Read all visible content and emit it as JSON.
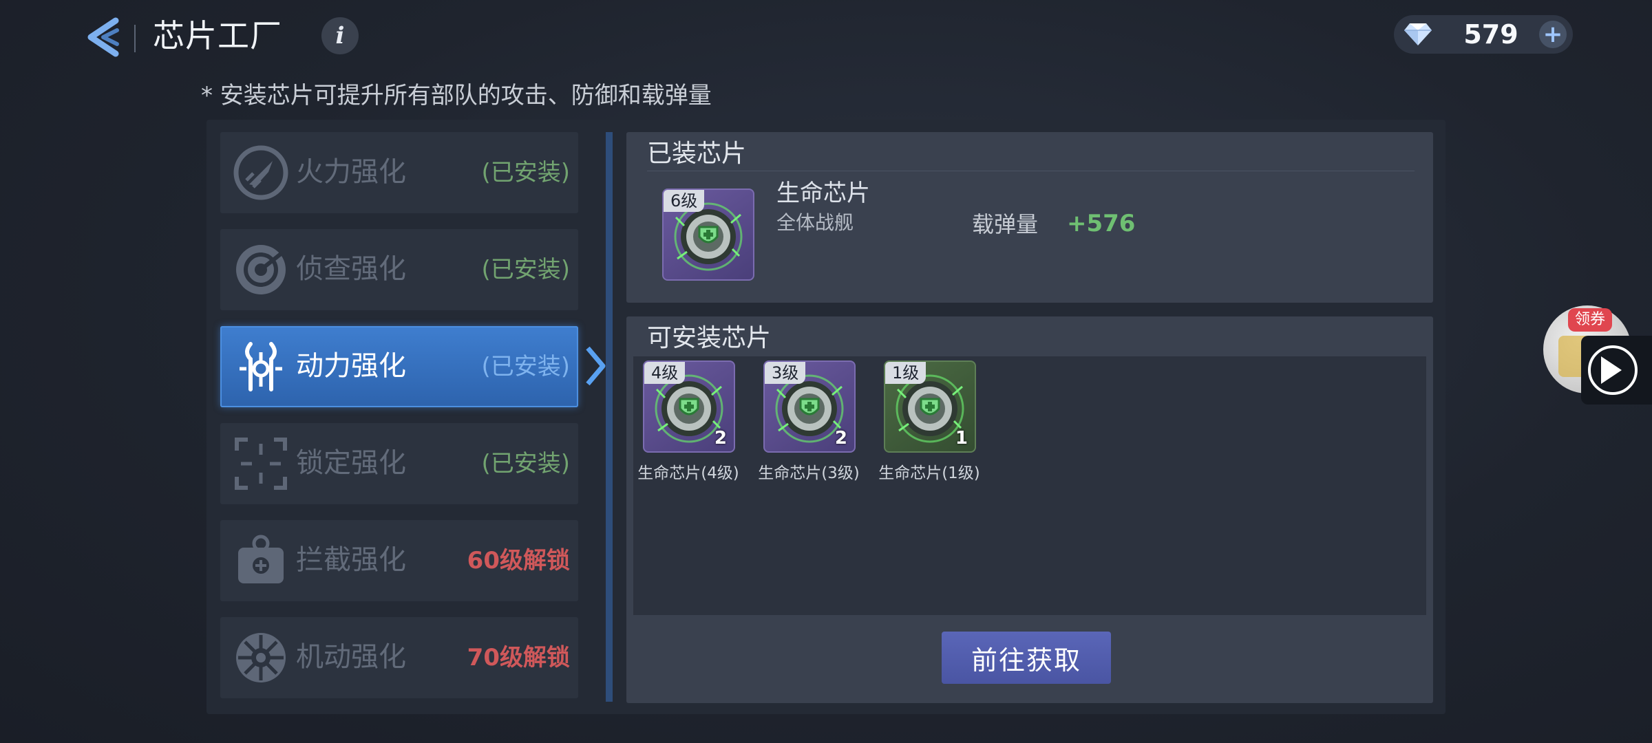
{
  "header": {
    "title": "芯片工厂",
    "info_icon": "i",
    "currency": {
      "icon": "diamond-icon",
      "amount": "579",
      "add_label": "+"
    }
  },
  "hint": "* 安装芯片可提升所有部队的攻击、防御和载弹量",
  "categories": [
    {
      "label": "火力强化",
      "status": "(已安装)",
      "icon": "rocket-icon",
      "state": "installed"
    },
    {
      "label": "侦查强化",
      "status": "(已安装)",
      "icon": "radar-icon",
      "state": "installed"
    },
    {
      "label": "动力强化",
      "status": "(已安装)",
      "icon": "engine-icon",
      "state": "active"
    },
    {
      "label": "锁定强化",
      "status": "(已安装)",
      "icon": "target-lock-icon",
      "state": "installed"
    },
    {
      "label": "拦截强化",
      "status": "60级解锁",
      "icon": "shield-box-icon",
      "state": "locked"
    },
    {
      "label": "机动强化",
      "status": "70级解锁",
      "icon": "gear-emblem-icon",
      "state": "locked"
    }
  ],
  "installed": {
    "title": "已装芯片",
    "chip": {
      "level": "6级",
      "name": "生命芯片",
      "target": "全体战舰"
    },
    "stat_label": "载弹量",
    "stat_value": "+576"
  },
  "available": {
    "title": "可安装芯片",
    "items": [
      {
        "level": "4级",
        "count": "2",
        "name": "生命芯片(4级)",
        "rarity": "purple"
      },
      {
        "level": "3级",
        "count": "2",
        "name": "生命芯片(3级)",
        "rarity": "purple"
      },
      {
        "level": "1级",
        "count": "1",
        "name": "生命芯片(1级)",
        "rarity": "green"
      }
    ],
    "button_label": "前往获取"
  },
  "side": {
    "coupon_label": "领券"
  },
  "colors": {
    "installed_status": "#72a470",
    "locked_status": "#d0585a",
    "active_tab": "#3f7ecf",
    "stat_value": "#6fbf72",
    "button": "#4a55a3"
  }
}
